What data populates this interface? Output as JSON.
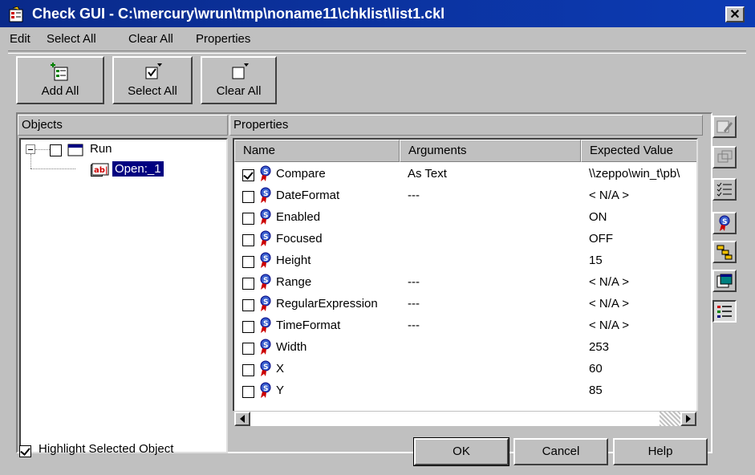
{
  "window": {
    "title": "Check GUI - C:\\mercury\\wrun\\tmp\\noname11\\chklist\\list1.ckl",
    "close_glyph": "✕"
  },
  "menu": [
    {
      "label": "Edit",
      "underline": "E"
    },
    {
      "label": "Select All",
      "underline": "S"
    },
    {
      "label": "Clear All",
      "underline": "C"
    },
    {
      "label": "Properties",
      "underline": "P"
    }
  ],
  "toolbar": {
    "add_all": "Add All",
    "select_all": "Select All",
    "clear_all": "Clear All"
  },
  "objects_panel": {
    "header": "Objects",
    "tree": {
      "root_label": "Run",
      "root_checked": false,
      "expander": "⊟",
      "child_label": "Open:_1",
      "child_checked": true
    }
  },
  "properties_panel": {
    "header": "Properties",
    "columns": [
      "Name",
      "Arguments",
      "Expected Value"
    ],
    "rows": [
      {
        "checked": true,
        "name": "Compare",
        "args": "As Text",
        "value": "\\\\zeppo\\win_t\\pb\\"
      },
      {
        "checked": false,
        "name": "DateFormat",
        "args": "---",
        "value": "< N/A >"
      },
      {
        "checked": false,
        "name": "Enabled",
        "args": "",
        "value": "ON"
      },
      {
        "checked": false,
        "name": "Focused",
        "args": "",
        "value": "OFF"
      },
      {
        "checked": false,
        "name": "Height",
        "args": "",
        "value": "15"
      },
      {
        "checked": false,
        "name": "Range",
        "args": "---",
        "value": "< N/A >"
      },
      {
        "checked": false,
        "name": "RegularExpression",
        "args": "---",
        "value": "< N/A >"
      },
      {
        "checked": false,
        "name": "TimeFormat",
        "args": "---",
        "value": "< N/A >"
      },
      {
        "checked": false,
        "name": "Width",
        "args": "",
        "value": "253"
      },
      {
        "checked": false,
        "name": "X",
        "args": "",
        "value": "60"
      },
      {
        "checked": false,
        "name": "Y",
        "args": "",
        "value": "85"
      }
    ]
  },
  "side_tools": [
    {
      "icon": "edit-arguments-icon"
    },
    {
      "icon": "copy-icon"
    },
    {
      "icon": "checklist-icon"
    },
    {
      "icon": "property-icon"
    },
    {
      "icon": "hierarchy-icon"
    },
    {
      "icon": "window-icon"
    },
    {
      "icon": "list-view-icon",
      "pressed": true
    }
  ],
  "footer": {
    "highlight_label": "Highlight Selected Object",
    "highlight_checked": true,
    "ok": "OK",
    "cancel": "Cancel",
    "help": "Help"
  },
  "colors": {
    "title_bar": "#0c3bb4",
    "face": "#c0c0c0",
    "selection": "#000080"
  }
}
